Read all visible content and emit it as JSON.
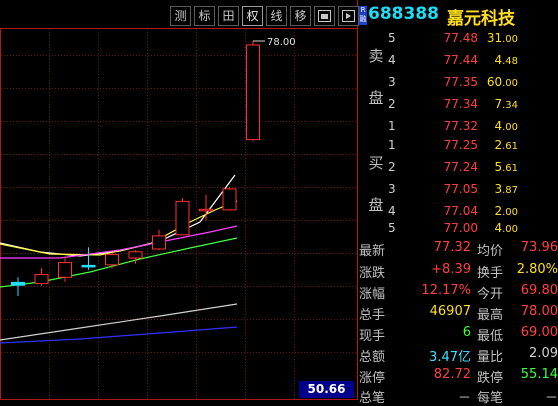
{
  "toolbar": {
    "buttons": [
      "测",
      "标",
      "田",
      "权",
      "线",
      "移",
      "▣",
      "▶"
    ]
  },
  "header": {
    "badge": "R融",
    "code": "688388",
    "name": "嘉元科技"
  },
  "chart": {
    "peak_label": "78.00",
    "current_price": "50.66",
    "candles": [
      {
        "o": 34.9,
        "h": 36.3,
        "l": 33.0,
        "c": 35.4,
        "up": false
      },
      {
        "o": 35.2,
        "h": 37.9,
        "l": 34.8,
        "c": 36.8,
        "up": true
      },
      {
        "o": 36.3,
        "h": 40.0,
        "l": 35.5,
        "c": 38.9,
        "up": true
      },
      {
        "o": 38.4,
        "h": 41.6,
        "l": 37.6,
        "c": 38.2,
        "up": false
      },
      {
        "o": 38.5,
        "h": 40.6,
        "l": 37.9,
        "c": 40.3,
        "up": true
      },
      {
        "o": 39.7,
        "h": 41.1,
        "l": 38.7,
        "c": 40.8,
        "up": true
      },
      {
        "o": 41.3,
        "h": 44.7,
        "l": 41.1,
        "c": 43.6,
        "up": true
      },
      {
        "o": 43.8,
        "h": 50.3,
        "l": 43.8,
        "c": 49.7,
        "up": true
      },
      {
        "o": 48.3,
        "h": 50.9,
        "l": 46.3,
        "c": 48.3,
        "up": true
      },
      {
        "o": 48.2,
        "h": 52.2,
        "l": 48.1,
        "c": 51.9,
        "up": true
      },
      {
        "o": 60.6,
        "h": 78.0,
        "l": 60.3,
        "c": 77.3,
        "up": true
      }
    ],
    "colors": {
      "up": "#ff3030",
      "down": "#20e0ff",
      "doji": "#20e0ff",
      "ma_white": "#ffffff",
      "ma_yellow": "#ffff40",
      "ma_magenta": "#ff40ff",
      "ma_green": "#40ff40",
      "ma_gray": "#d0d0d0",
      "ma_blue": "#3030ff"
    }
  },
  "order_book": {
    "sell_label": [
      "卖",
      "盘"
    ],
    "buy_label": [
      "买",
      "盘"
    ],
    "asks": [
      {
        "level": "5",
        "price": "77.48",
        "vol_int": "31",
        "vol_dec": ".00"
      },
      {
        "level": "4",
        "price": "77.44",
        "vol_int": "4",
        "vol_dec": ".48"
      },
      {
        "level": "3",
        "price": "77.35",
        "vol_int": "60",
        "vol_dec": ".00"
      },
      {
        "level": "2",
        "price": "77.34",
        "vol_int": "7",
        "vol_dec": ".34"
      },
      {
        "level": "1",
        "price": "77.32",
        "vol_int": "4",
        "vol_dec": ".00"
      }
    ],
    "bids": [
      {
        "level": "1",
        "price": "77.25",
        "vol_int": "2",
        "vol_dec": ".61"
      },
      {
        "level": "2",
        "price": "77.24",
        "vol_int": "5",
        "vol_dec": ".61"
      },
      {
        "level": "3",
        "price": "77.05",
        "vol_int": "3",
        "vol_dec": ".87"
      },
      {
        "level": "4",
        "price": "77.04",
        "vol_int": "2",
        "vol_dec": ".00"
      },
      {
        "level": "5",
        "price": "77.00",
        "vol_int": "4",
        "vol_dec": ".00"
      }
    ],
    "colors": {
      "price": "#ff4040",
      "volume": "#ffdf20"
    }
  },
  "stats": [
    {
      "k1": "最新",
      "v1": "77.32",
      "c1": "#ff4040",
      "k2": "均价",
      "v2": "73.96",
      "c2": "#ff4040"
    },
    {
      "k1": "涨跌",
      "v1": "+8.39",
      "c1": "#ff4040",
      "k2": "换手",
      "v2": "2.80%",
      "c2": "#ffdf20"
    },
    {
      "k1": "涨幅",
      "v1": "12.17%",
      "c1": "#ff4040",
      "k2": "今开",
      "v2": "69.80",
      "c2": "#ff4040"
    },
    {
      "k1": "总手",
      "v1": "46907",
      "c1": "#ffdf20",
      "k2": "最高",
      "v2": "78.00",
      "c2": "#ff4040"
    },
    {
      "k1": "现手",
      "v1": "6",
      "c1": "#40ff40",
      "k2": "最低",
      "v2": "69.00",
      "c2": "#ff4040"
    },
    {
      "k1": "总额",
      "v1": "3.47亿",
      "c1": "#40e0ff",
      "k2": "量比",
      "v2": "2.09",
      "c2": "#d0d0d0"
    },
    {
      "k1": "涨停",
      "v1": "82.72",
      "c1": "#ff4040",
      "k2": "跌停",
      "v2": "55.14",
      "c2": "#40ff40"
    },
    {
      "k1": "总笔",
      "v1": "－",
      "c1": "#d0d0d0",
      "k2": "每笔",
      "v2": "－",
      "c2": "#d0d0d0"
    }
  ]
}
